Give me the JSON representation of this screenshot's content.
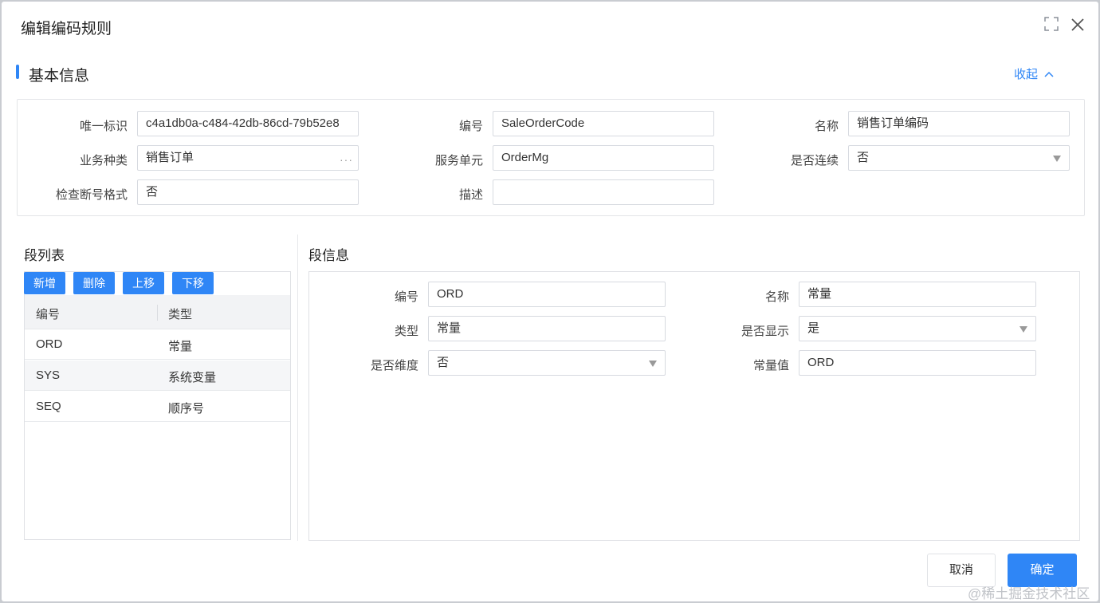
{
  "dialog": {
    "title": "编辑编码规则"
  },
  "basic": {
    "title": "基本信息",
    "collapse_label": "收起",
    "fields": {
      "uid": {
        "label": "唯一标识",
        "value": "c4a1db0a-c484-42db-86cd-79b52e8"
      },
      "code": {
        "label": "编号",
        "value": "SaleOrderCode"
      },
      "name": {
        "label": "名称",
        "value": "销售订单编码"
      },
      "biz_type": {
        "label": "业务种类",
        "value": "销售订单"
      },
      "service_unit": {
        "label": "服务单元",
        "value": "OrderMg"
      },
      "continuous": {
        "label": "是否连续",
        "value": "否"
      },
      "check_format": {
        "label": "检查断号格式",
        "value": "否"
      },
      "desc": {
        "label": "描述",
        "value": ""
      }
    }
  },
  "segment_list": {
    "title": "段列表",
    "buttons": {
      "add": "新增",
      "delete": "删除",
      "up": "上移",
      "down": "下移"
    },
    "columns": [
      "编号",
      "类型"
    ],
    "rows": [
      {
        "code": "ORD",
        "type": "常量"
      },
      {
        "code": "SYS",
        "type": "系统变量"
      },
      {
        "code": "SEQ",
        "type": "顺序号"
      }
    ]
  },
  "segment_info": {
    "title": "段信息",
    "fields": {
      "code": {
        "label": "编号",
        "value": "ORD"
      },
      "name": {
        "label": "名称",
        "value": "常量"
      },
      "type": {
        "label": "类型",
        "value": "常量"
      },
      "visible": {
        "label": "是否显示",
        "value": "是"
      },
      "dimension": {
        "label": "是否维度",
        "value": "否"
      },
      "const_value": {
        "label": "常量值",
        "value": "ORD"
      }
    }
  },
  "footer": {
    "cancel": "取消",
    "ok": "确定"
  },
  "watermark": "@稀土掘金技术社区",
  "colors": {
    "accent": "#2f86f6"
  }
}
